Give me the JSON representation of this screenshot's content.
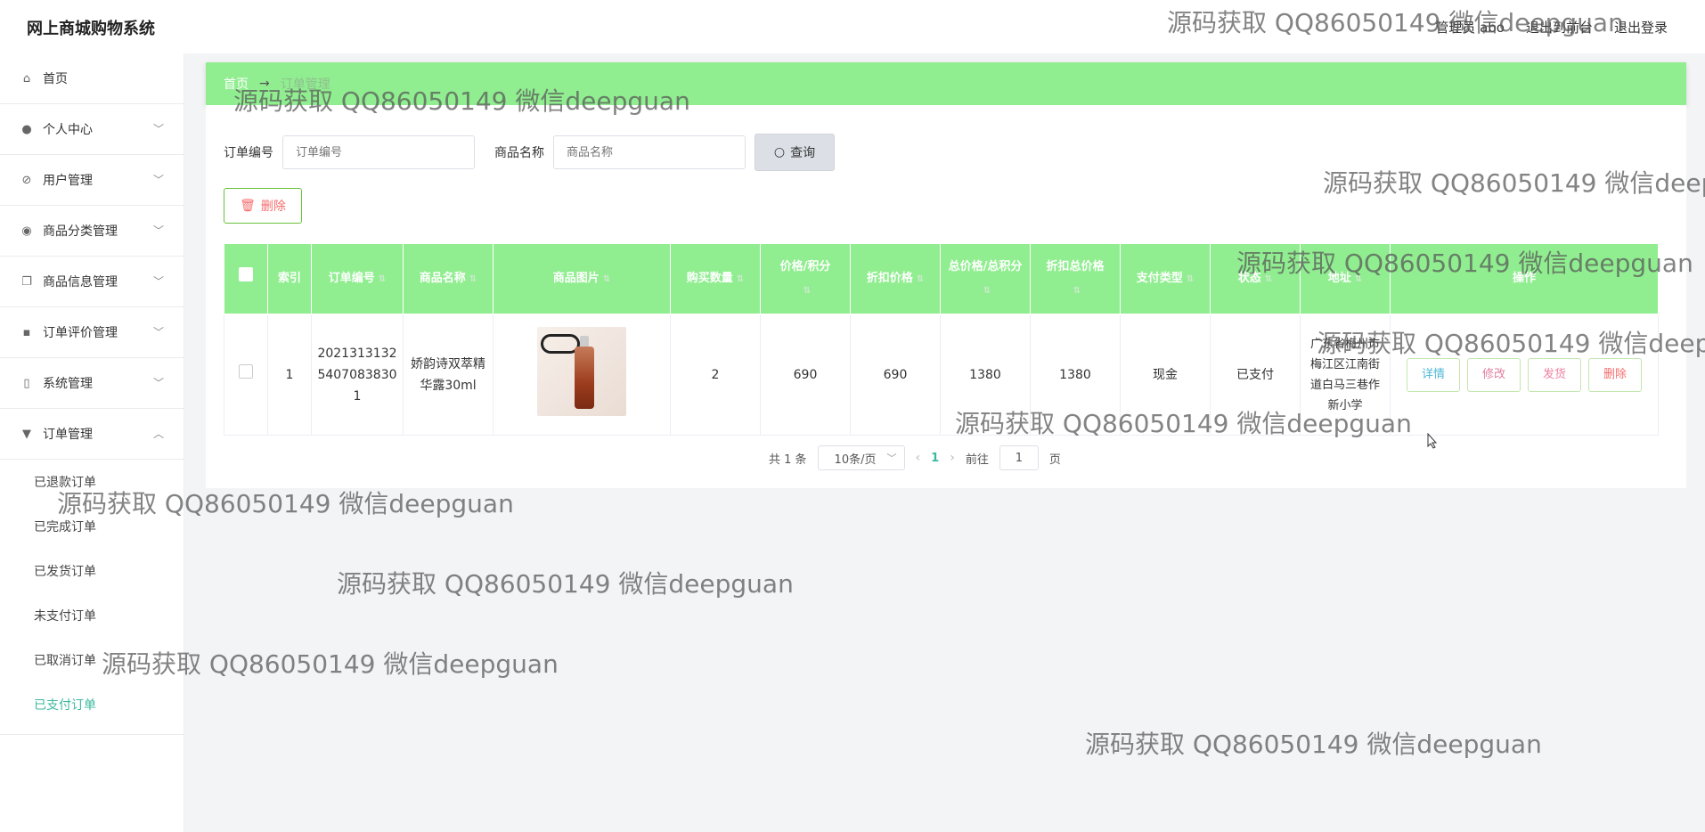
{
  "app": {
    "title": "网上商城购物系统"
  },
  "header": {
    "user": "管理员 abo",
    "back_front": "退出到前台",
    "logout": "退出登录"
  },
  "sidebar": {
    "items": [
      {
        "label": "首页",
        "icon": "home-icon",
        "hasChevron": false
      },
      {
        "label": "个人中心",
        "icon": "user-icon",
        "hasChevron": true
      },
      {
        "label": "用户管理",
        "icon": "users-icon",
        "hasChevron": true
      },
      {
        "label": "商品分类管理",
        "icon": "category-icon",
        "hasChevron": true
      },
      {
        "label": "商品信息管理",
        "icon": "copy-icon",
        "hasChevron": true
      },
      {
        "label": "订单评价管理",
        "icon": "chat-icon",
        "hasChevron": true
      },
      {
        "label": "系统管理",
        "icon": "system-icon",
        "hasChevron": true
      },
      {
        "label": "订单管理",
        "icon": "order-icon",
        "hasChevron": true,
        "expanded": true
      }
    ],
    "subitems": [
      "已退款订单",
      "已完成订单",
      "已发货订单",
      "未支付订单",
      "已取消订单",
      "已支付订单"
    ],
    "active_sub": "已支付订单"
  },
  "breadcrumb": {
    "home": "首页",
    "arrow": "→",
    "current": "订单管理"
  },
  "search": {
    "order_no_label": "订单编号",
    "order_no_placeholder": "订单编号",
    "product_label": "商品名称",
    "product_placeholder": "商品名称",
    "query_button": "查询"
  },
  "toolbar": {
    "delete_button": "删除"
  },
  "table": {
    "columns": [
      "索引",
      "订单编号",
      "商品名称",
      "商品图片",
      "购买数量",
      "价格/积分",
      "折扣价格",
      "总价格/总积分",
      "折扣总价格",
      "支付类型",
      "状态",
      "地址",
      "操作"
    ],
    "rows": [
      {
        "index": "1",
        "order_no": "202131313254070838301",
        "product": "娇韵诗双萃精华露30ml",
        "qty": "2",
        "price": "690",
        "discount_price": "690",
        "total": "1380",
        "discount_total": "1380",
        "pay_type": "现金",
        "status": "已支付",
        "address": "广东省梅州市梅江区江南街道白马三巷作新小学"
      }
    ],
    "ops": [
      "详情",
      "修改",
      "发货",
      "删除"
    ]
  },
  "pagination": {
    "total": "共 1 条",
    "page_size": "10条/页",
    "current_page": "1",
    "goto_label": "前往",
    "goto_value": "1",
    "page_suffix": "页"
  },
  "watermark": "源码获取 QQ86050149 微信deepguan",
  "colors": {
    "header_green": "#90ee90",
    "active_teal": "#3cb8a0",
    "danger": "#f56c6c",
    "detail": "#4fb8d8",
    "edit": "#e080a0",
    "ship": "#f080a0"
  }
}
